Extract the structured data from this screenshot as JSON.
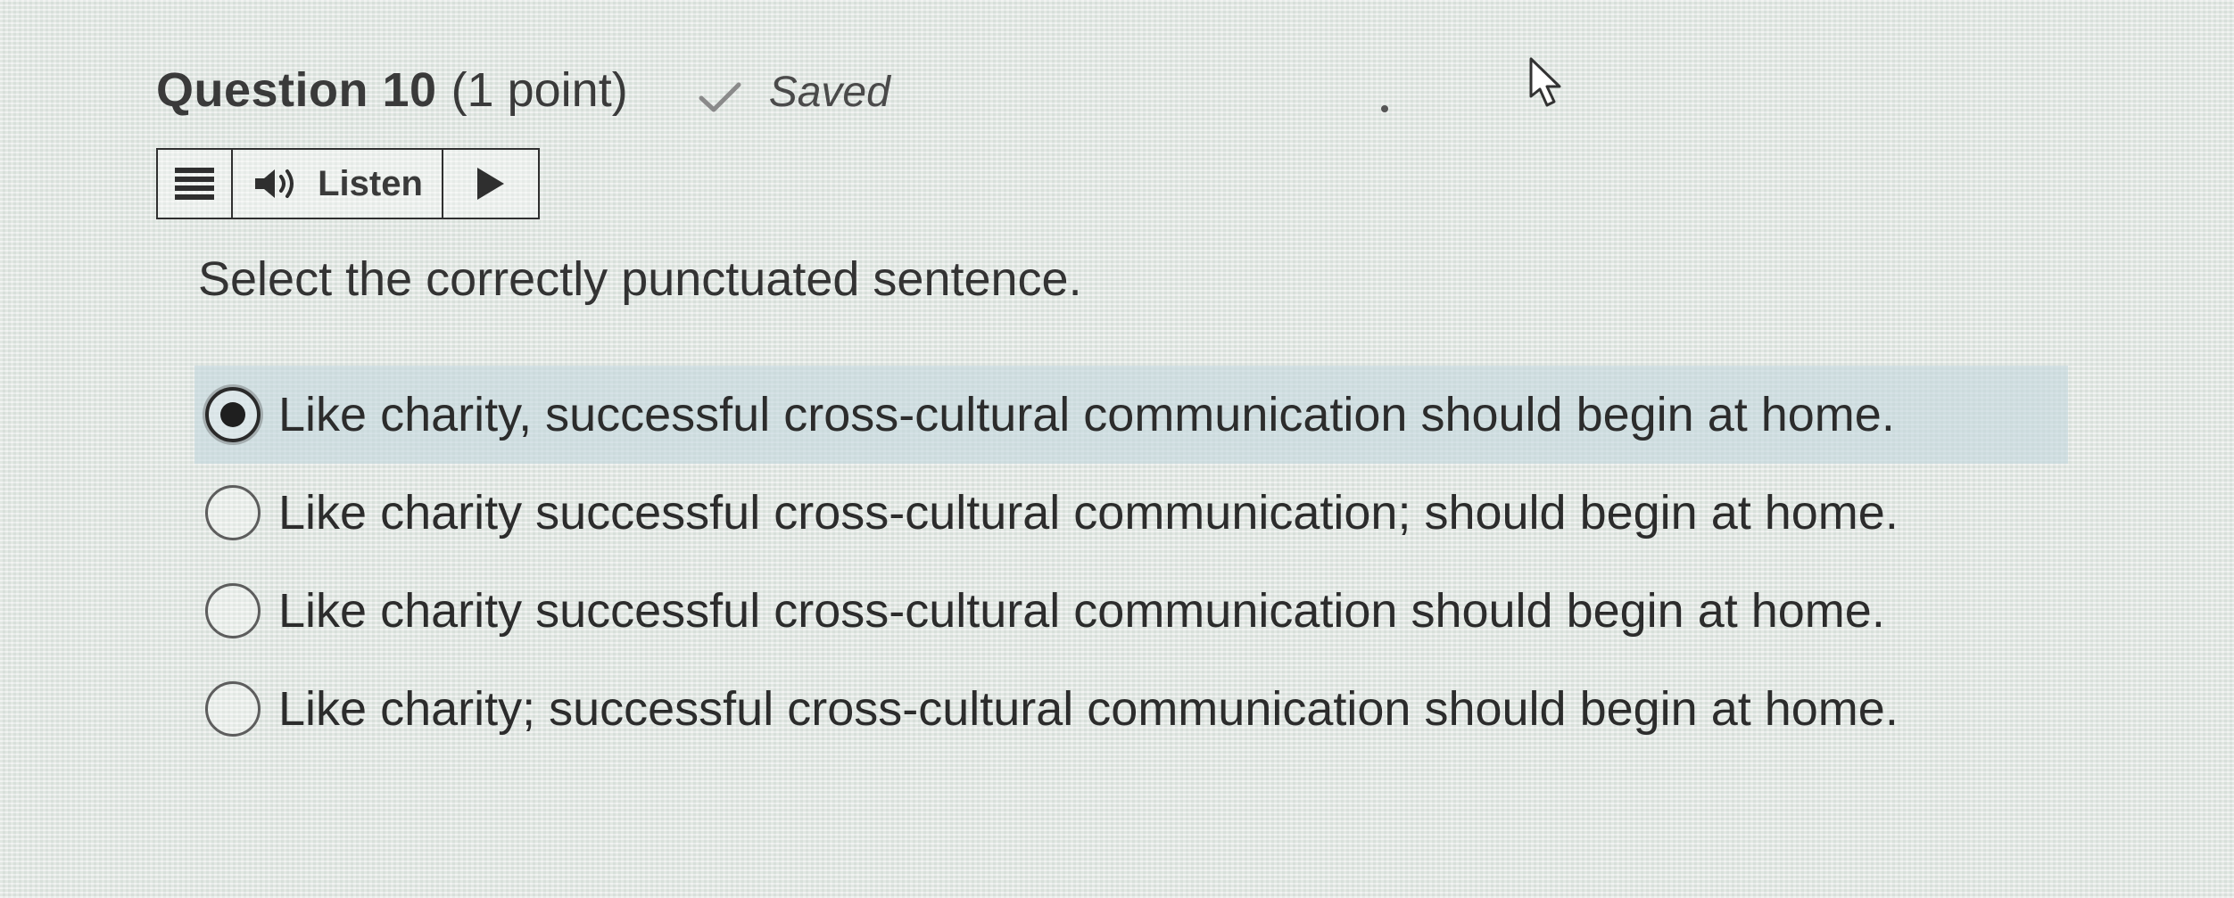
{
  "question": {
    "title": "Question 10",
    "points": "(1 point)",
    "status": "Saved"
  },
  "toolbar": {
    "listen_label": "Listen"
  },
  "prompt": "Select the correctly punctuated sentence.",
  "options": [
    {
      "text": "Like charity, successful cross-cultural communication should begin at home.",
      "selected": true
    },
    {
      "text": "Like charity successful cross-cultural communication; should begin at home.",
      "selected": false
    },
    {
      "text": "Like charity successful cross-cultural communication should begin at home.",
      "selected": false
    },
    {
      "text": "Like charity; successful cross-cultural communication should begin at home.",
      "selected": false
    }
  ],
  "colors": {
    "text": "#2c2c2c",
    "selected_highlight": "#c3d7de",
    "border": "#2f2f2f"
  }
}
